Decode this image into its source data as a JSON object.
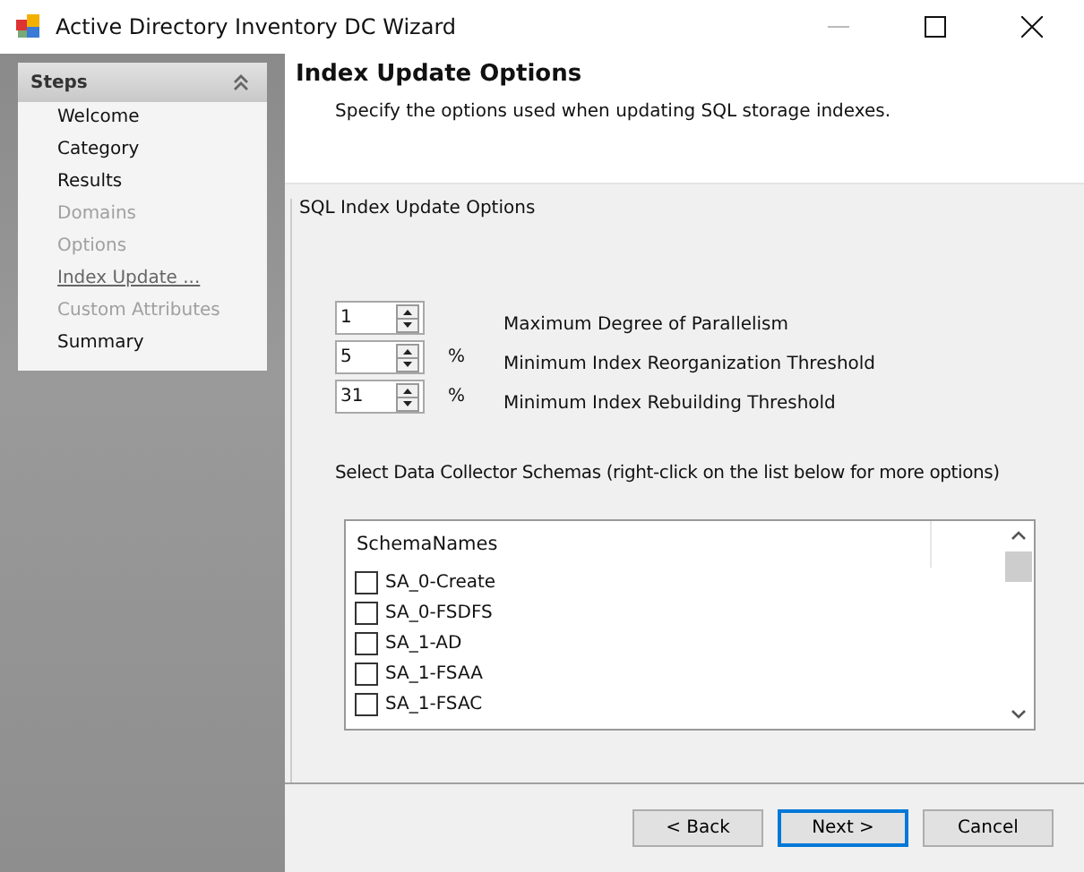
{
  "window": {
    "title": "Active Directory Inventory DC Wizard"
  },
  "sidebar": {
    "title": "Steps",
    "items": [
      {
        "label": "Welcome",
        "disabled": false,
        "selected": false
      },
      {
        "label": "Category",
        "disabled": false,
        "selected": false
      },
      {
        "label": "Results",
        "disabled": false,
        "selected": false
      },
      {
        "label": "Domains",
        "disabled": true,
        "selected": false
      },
      {
        "label": "Options",
        "disabled": true,
        "selected": false
      },
      {
        "label": "Index Update ...",
        "disabled": false,
        "selected": true
      },
      {
        "label": "Custom Attributes",
        "disabled": true,
        "selected": false
      },
      {
        "label": "Summary",
        "disabled": false,
        "selected": false
      }
    ]
  },
  "header": {
    "title": "Index Update Options",
    "subtitle": "Specify the options used when updating SQL storage indexes."
  },
  "group": {
    "title": "SQL Index Update Options",
    "settings": [
      {
        "value": "1",
        "label": "Maximum Degree of Parallelism"
      },
      {
        "value": "5",
        "unit": "%",
        "label": "Minimum Index Reorganization Threshold"
      },
      {
        "value": "31",
        "unit": "%",
        "label": "Minimum Index Rebuilding Threshold"
      }
    ],
    "list_caption": "Select Data Collector Schemas (right-click on the list below for more options)",
    "list": {
      "column": "SchemaNames",
      "rows": [
        {
          "name": "SA_0-Create",
          "checked": false
        },
        {
          "name": "SA_0-FSDFS",
          "checked": false
        },
        {
          "name": "SA_1-AD",
          "checked": false
        },
        {
          "name": "SA_1-FSAA",
          "checked": false
        },
        {
          "name": "SA_1-FSAC",
          "checked": false
        }
      ]
    }
  },
  "buttons": [
    {
      "label": "< Back",
      "default": false
    },
    {
      "label": "Next >",
      "default": true
    },
    {
      "label": "Cancel",
      "default": false
    }
  ]
}
